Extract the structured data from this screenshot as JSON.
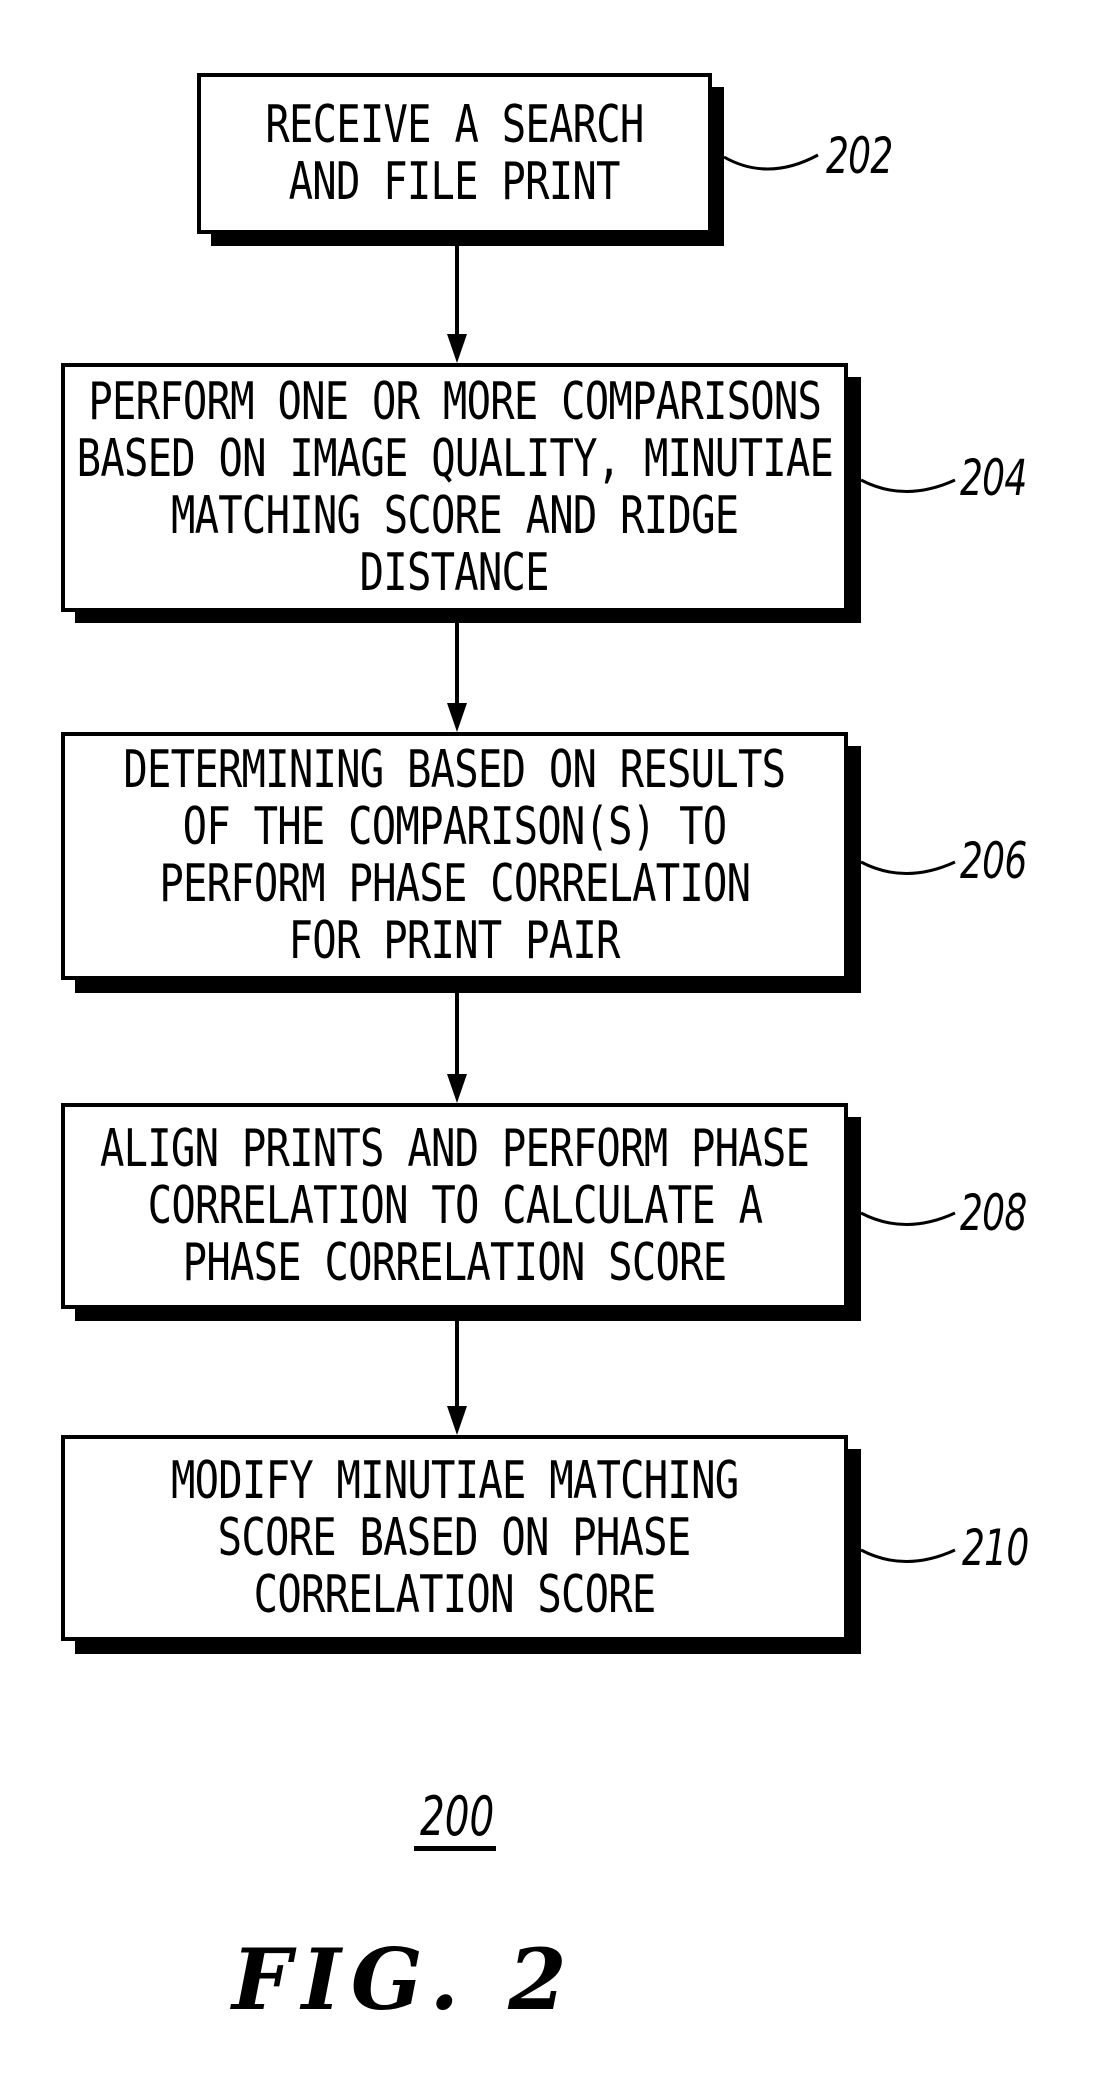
{
  "figure": {
    "diagram_number": "200",
    "caption": "FIG. 2"
  },
  "steps": [
    {
      "ref": "202",
      "lines": [
        "RECEIVE A SEARCH",
        "AND FILE PRINT"
      ]
    },
    {
      "ref": "204",
      "lines": [
        "PERFORM ONE OR MORE COMPARISONS",
        "BASED ON IMAGE QUALITY, MINUTIAE",
        "MATCHING SCORE AND RIDGE",
        "DISTANCE"
      ]
    },
    {
      "ref": "206",
      "lines": [
        "DETERMINING BASED ON RESULTS",
        "OF THE COMPARISON(S) TO",
        "PERFORM PHASE CORRELATION",
        "FOR PRINT PAIR"
      ]
    },
    {
      "ref": "208",
      "lines": [
        "ALIGN PRINTS AND PERFORM PHASE",
        "CORRELATION TO CALCULATE A",
        "PHASE CORRELATION SCORE"
      ]
    },
    {
      "ref": "210",
      "lines": [
        "MODIFY MINUTIAE MATCHING",
        "SCORE BASED ON PHASE",
        "CORRELATION SCORE"
      ]
    }
  ]
}
